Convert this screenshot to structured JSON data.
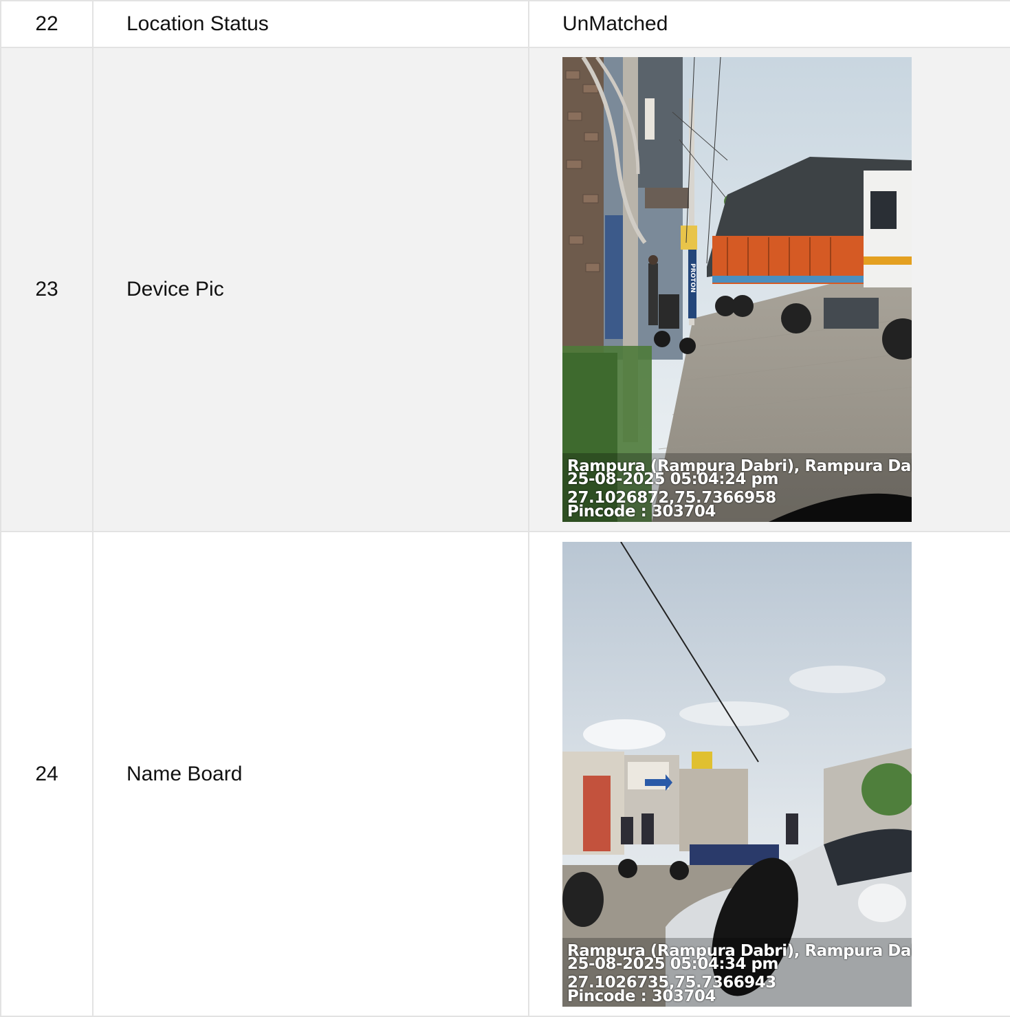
{
  "rows": [
    {
      "num": "22",
      "label": "Location Status",
      "value": "UnMatched"
    },
    {
      "num": "23",
      "label": "Device Pic",
      "photo": {
        "address": "Rampura (Rampura Dabri), Rampura Dabri, R",
        "datetime": "25-08-2025 05:04:24 pm",
        "coords": "27.1026872,75.7366958",
        "pincode": "Pincode : 303704",
        "sign_text": "PROTON"
      }
    },
    {
      "num": "24",
      "label": "Name Board",
      "photo": {
        "address": "Rampura (Rampura Dabri), Rampura Dabri, R",
        "datetime": "25-08-2025 05:04:34 pm",
        "coords": "27.1026735,75.7366943",
        "pincode": "Pincode : 303704"
      }
    }
  ],
  "colors": {
    "border": "#e2e2e2",
    "alt_row": "#f2f2f2"
  }
}
